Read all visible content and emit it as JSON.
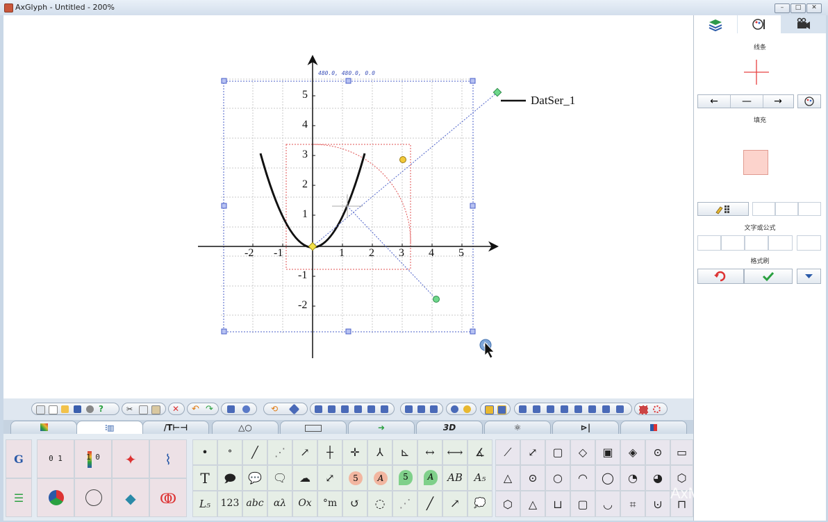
{
  "window": {
    "title": "AxGlyph - Untitled - 200%",
    "buttons": [
      "min",
      "max",
      "close"
    ]
  },
  "canvas": {
    "coord_label": "480.0, 480.0, 0.0",
    "legend_label": "DatSer_1",
    "x_ticks": [
      "-2",
      "-1",
      "1",
      "2",
      "3",
      "4",
      "5"
    ],
    "y_ticks": [
      "5",
      "4",
      "3",
      "2",
      "1",
      "-1",
      "-2"
    ]
  },
  "right_panel": {
    "tabs": [
      {
        "icon": "layers-icon"
      },
      {
        "icon": "palette-icon"
      },
      {
        "icon": "camera-icon"
      }
    ],
    "line_label": "线条",
    "fill_label": "填充",
    "text_label": "文字或公式",
    "brush_label": "格式刷",
    "line_color": "#e84040",
    "fill_color": "#fcd3cc"
  },
  "palette_tabs": [
    {
      "label": "",
      "icon": "color-tab-icon"
    },
    {
      "label": "",
      "icon": "chart-tab-icon"
    },
    {
      "label": "/T⊢⊣",
      "icon": ""
    },
    {
      "label": "△○",
      "icon": ""
    },
    {
      "label": "",
      "icon": "flow-tab-icon"
    },
    {
      "label": "➜",
      "icon": ""
    },
    {
      "label": "3D",
      "icon": ""
    },
    {
      "label": "",
      "icon": "physics-tab-icon"
    },
    {
      "label": "",
      "icon": "circuit-tab-icon"
    },
    {
      "label": "",
      "icon": "grid-tab-icon"
    }
  ],
  "palette": {
    "text_tools_row2": [
      "T",
      "5",
      "A",
      "5",
      "A",
      "AB",
      "A₅"
    ],
    "text_tools_row3": [
      "L₅",
      "123",
      "abc",
      "αλ",
      "Ox",
      "°m"
    ],
    "axis_tool": "0 1",
    "colorbar_tool": "1 0"
  },
  "watermark": "AxMath"
}
